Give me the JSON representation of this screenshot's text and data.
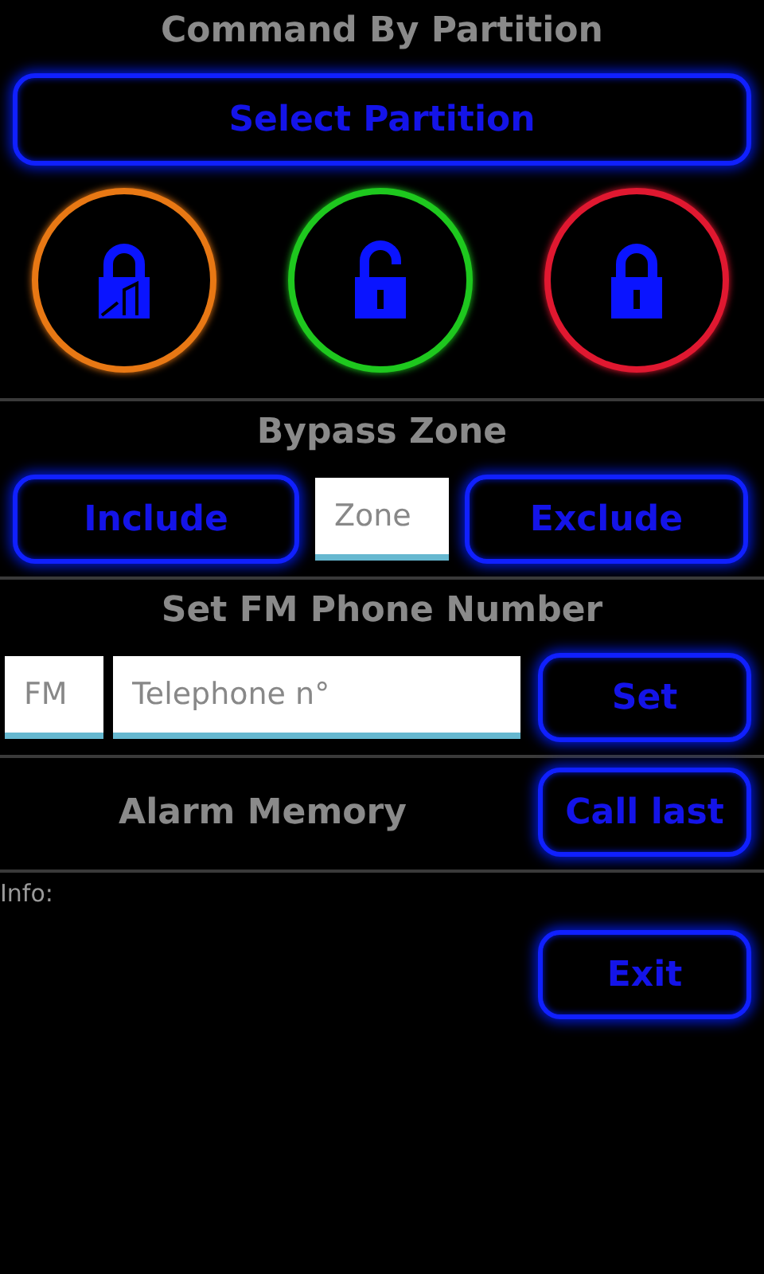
{
  "title": "Command By Partition",
  "select_button": "Select Partition",
  "lock_buttons": [
    {
      "kind": "partial",
      "color": "#e87814"
    },
    {
      "kind": "open",
      "color": "#1ec81e"
    },
    {
      "kind": "closed",
      "color": "#e01830"
    }
  ],
  "bypass": {
    "title": "Bypass Zone",
    "include": "Include",
    "zone_placeholder": "Zone",
    "exclude": "Exclude"
  },
  "phone": {
    "title": "Set FM Phone Number",
    "prefix_placeholder": "FM",
    "number_placeholder": "Telephone n°",
    "set": "Set"
  },
  "alarm": {
    "title": "Alarm Memory",
    "call_last": "Call last"
  },
  "info_label": "Info:",
  "exit": "Exit"
}
